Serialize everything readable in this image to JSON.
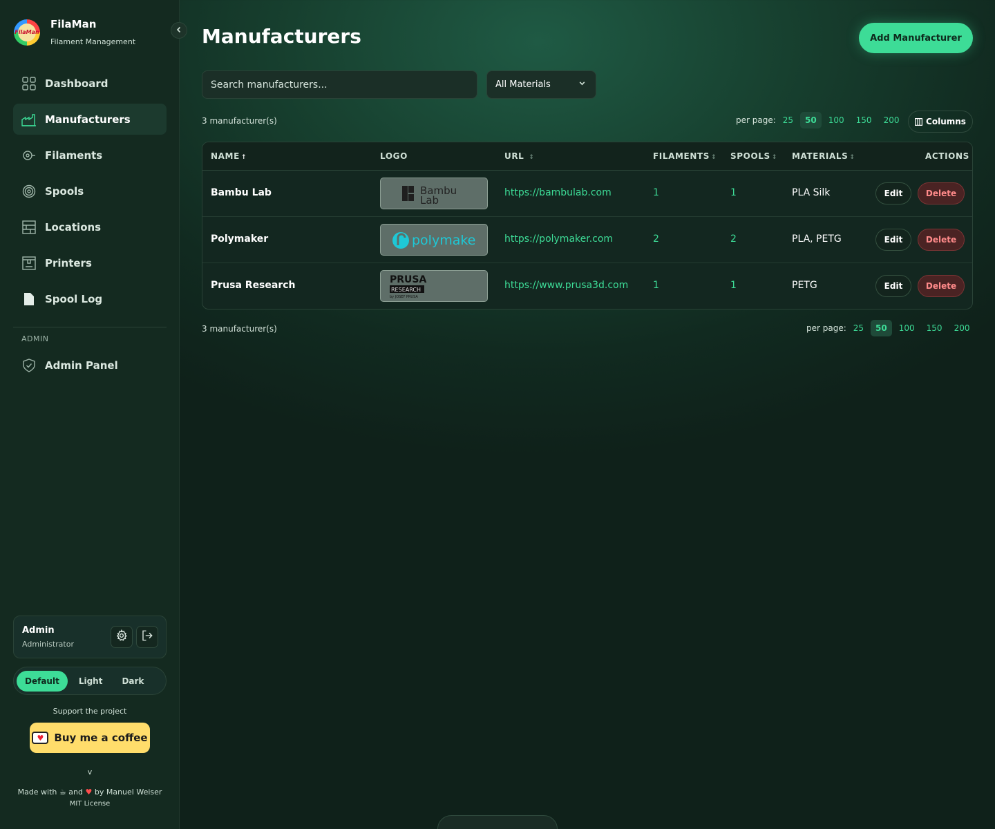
{
  "brand": {
    "title": "FilaMan",
    "subtitle": "Filament Management",
    "logo_text": "FilaMan"
  },
  "nav": {
    "items": [
      {
        "label": "Dashboard",
        "icon": "grid-icon"
      },
      {
        "label": "Manufacturers",
        "icon": "factory-icon",
        "active": true
      },
      {
        "label": "Filaments",
        "icon": "filament-icon"
      },
      {
        "label": "Spools",
        "icon": "spool-icon"
      },
      {
        "label": "Locations",
        "icon": "shelf-icon"
      },
      {
        "label": "Printers",
        "icon": "printer-icon"
      },
      {
        "label": "Spool Log",
        "icon": "document-icon"
      }
    ],
    "admin_label": "ADMIN",
    "admin_item": {
      "label": "Admin Panel",
      "icon": "shield-icon"
    }
  },
  "user": {
    "name": "Admin",
    "role": "Administrator"
  },
  "theme": {
    "options": [
      "Default",
      "Light",
      "Dark"
    ],
    "selected": "Default"
  },
  "support": {
    "text": "Support the project",
    "coffee_label": "Buy me a coffee"
  },
  "footer": {
    "version": "v",
    "made_prefix": "Made with",
    "and": "and",
    "by": "by Manuel Weiser",
    "license": "MIT License"
  },
  "page": {
    "title": "Manufacturers",
    "add_button": "Add Manufacturer"
  },
  "filters": {
    "search_placeholder": "Search manufacturers...",
    "material_select": "All Materials"
  },
  "pagination": {
    "count_text": "3 manufacturer(s)",
    "per_page_label": "per page:",
    "options": [
      "25",
      "50",
      "100",
      "150",
      "200"
    ],
    "selected": "50",
    "columns_label": "Columns"
  },
  "table": {
    "headers": {
      "name": "NAME",
      "logo": "LOGO",
      "url": "URL",
      "filaments": "FILAMENTS",
      "spools": "SPOOLS",
      "materials": "MATERIALS",
      "actions": "ACTIONS"
    },
    "sort_up": "↑",
    "sort_both": "↕",
    "rows": [
      {
        "name": "Bambu Lab",
        "logo_text": "Bambu Lab",
        "url": "https://bambulab.com",
        "filaments": "1",
        "spools": "1",
        "materials": "PLA Silk"
      },
      {
        "name": "Polymaker",
        "logo_text": "polymaker",
        "url": "https://polymaker.com",
        "filaments": "2",
        "spools": "2",
        "materials": "PLA, PETG"
      },
      {
        "name": "Prusa Research",
        "logo_text": "PRUSA RESEARCH",
        "url": "https://www.prusa3d.com",
        "filaments": "1",
        "spools": "1",
        "materials": "PETG"
      }
    ],
    "edit_label": "Edit",
    "delete_label": "Delete"
  },
  "colors": {
    "accent": "#3ddc97",
    "danger": "#ff8a8a",
    "sidebar_bg": "#142a20",
    "coffee": "#ffdd6b"
  }
}
